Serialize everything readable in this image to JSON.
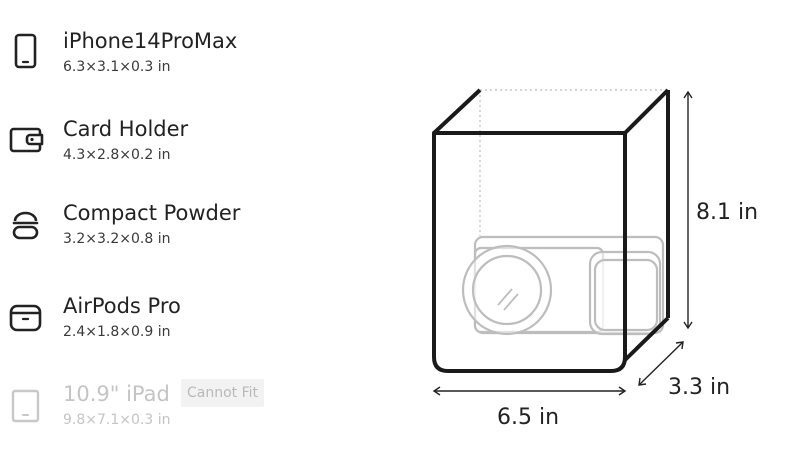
{
  "items": [
    {
      "name": "iPhone14ProMax",
      "dims": "6.3×3.1×0.3 in",
      "icon": "phone-icon",
      "fits": true
    },
    {
      "name": "Card Holder",
      "dims": "4.3×2.8×0.2 in",
      "icon": "wallet-icon",
      "fits": true
    },
    {
      "name": "Compact Powder",
      "dims": "3.2×3.2×0.8 in",
      "icon": "compact-powder-icon",
      "fits": true
    },
    {
      "name": "AirPods Pro",
      "dims": "2.4×1.8×0.9 in",
      "icon": "airpods-case-icon",
      "fits": true
    },
    {
      "name": "10.9\" iPad",
      "dims": "9.8×7.1×0.3 in",
      "icon": "tablet-icon",
      "fits": false,
      "badge": "Cannot Fit"
    }
  ],
  "bag": {
    "height": "8.1 in",
    "depth": "3.3 in",
    "width": "6.5 in"
  },
  "colors": {
    "outline": "#1a1a1a",
    "disabled_text": "#c4c4c4",
    "badge_bg": "#f2f2f2",
    "ghost_items": "#bdbdbd"
  }
}
